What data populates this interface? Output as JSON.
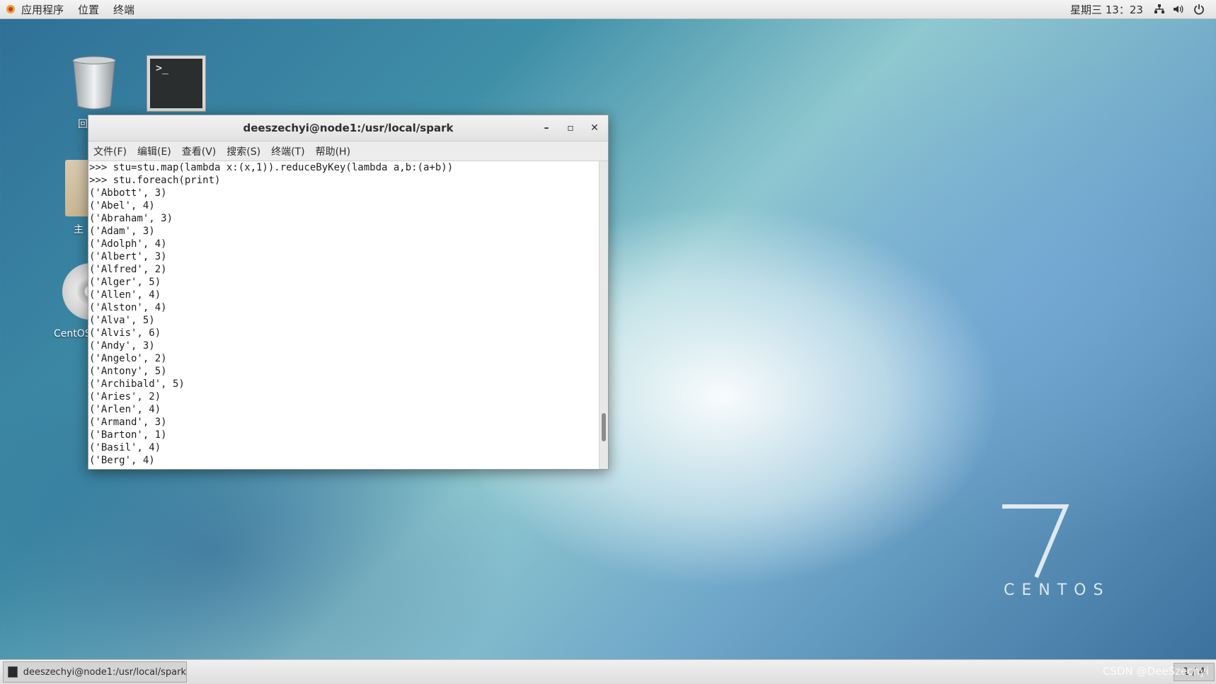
{
  "topbar": {
    "apps": "应用程序",
    "places": "位置",
    "terminal": "终端",
    "clock": "星期三 13：23",
    "icons": [
      "network-icon",
      "volume-icon",
      "power-icon"
    ]
  },
  "desktop": {
    "trash_label": "回",
    "home_label": "主",
    "disc_label": "CentOS",
    "brand_number": "7",
    "brand_text": "CENTOS"
  },
  "window": {
    "title": "deeszechyi@node1:/usr/local/spark",
    "menu": [
      "文件(F)",
      "编辑(E)",
      "查看(V)",
      "搜索(S)",
      "终端(T)",
      "帮助(H)"
    ],
    "lines": [
      ">>> stu=stu.map(lambda x:(x,1)).reduceByKey(lambda a,b:(a+b))",
      ">>> stu.foreach(print)",
      "('Abbott', 3)",
      "('Abel', 4)",
      "('Abraham', 3)",
      "('Adam', 3)",
      "('Adolph', 4)",
      "('Albert', 3)",
      "('Alfred', 2)",
      "('Alger', 5)",
      "('Allen', 4)",
      "('Alston', 4)",
      "('Alva', 5)",
      "('Alvis', 6)",
      "('Andy', 3)",
      "('Angelo', 2)",
      "('Antony', 5)",
      "('Archibald', 5)",
      "('Aries', 2)",
      "('Arlen', 4)",
      "('Armand', 3)",
      "('Barton', 1)",
      "('Basil', 4)",
      "('Berg', 4)"
    ]
  },
  "taskbar": {
    "task_label": "deeszechyi@node1:/usr/local/spark",
    "pager": "1 / 4",
    "watermark": "CSDN @DeeSzechyi"
  }
}
